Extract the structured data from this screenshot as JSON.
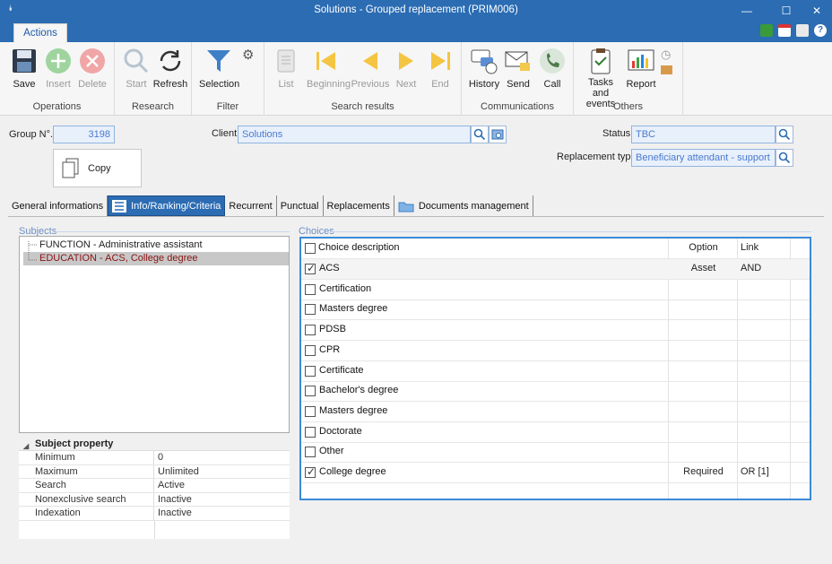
{
  "window": {
    "title": "Solutions - Grouped replacement (PRIM006)",
    "minimize": "—",
    "maximize": "☐",
    "close": "✕"
  },
  "ribbon_tab": "Actions",
  "ribbon": {
    "groups": [
      {
        "label": "Operations"
      },
      {
        "label": "Research"
      },
      {
        "label": "Filter"
      },
      {
        "label": "Search results"
      },
      {
        "label": "Communications"
      },
      {
        "label": "Others"
      }
    ],
    "buttons": {
      "save": "Save",
      "insert": "Insert",
      "delete": "Delete",
      "start": "Start",
      "refresh": "Refresh",
      "selection": "Selection",
      "list": "List",
      "beginning": "Beginning",
      "previous": "Previous",
      "next": "Next",
      "end": "End",
      "history": "History",
      "send": "Send",
      "call": "Call",
      "tasks_events": "Tasks and events",
      "report": "Report"
    }
  },
  "form": {
    "group_no_label": "Group N°.",
    "group_no_value": "3198",
    "client_label": "Client",
    "client_value": "Solutions",
    "status_label": "Status",
    "status_value": "TBC",
    "replacement_type_label": "Replacement type",
    "replacement_type_value": "Beneficiary attendant - support",
    "copy_button": "Copy"
  },
  "tabs": [
    {
      "label": "General informations"
    },
    {
      "label": "Info/Ranking/Criteria"
    },
    {
      "label": "Recurrent"
    },
    {
      "label": "Punctual"
    },
    {
      "label": "Replacements"
    },
    {
      "label": "Documents management"
    }
  ],
  "subjects": {
    "title": "Subjects",
    "items": [
      {
        "label": "FUNCTION - Administrative assistant"
      },
      {
        "label": "EDUCATION - ACS, College degree"
      }
    ]
  },
  "subject_property": {
    "title": "Subject property",
    "rows": [
      {
        "key": "Minimum",
        "value": "0"
      },
      {
        "key": "Maximum",
        "value": "Unlimited"
      },
      {
        "key": "Search",
        "value": "Active"
      },
      {
        "key": "Nonexclusive search",
        "value": "Inactive"
      },
      {
        "key": "Indexation",
        "value": "Inactive"
      }
    ]
  },
  "choices": {
    "title": "Choices",
    "header": {
      "description": "Choice description",
      "option": "Option",
      "link": "Link"
    },
    "rows": [
      {
        "label": "ACS",
        "checked": true,
        "option": "Asset",
        "link": "AND"
      },
      {
        "label": "Certification",
        "checked": false,
        "option": "",
        "link": ""
      },
      {
        "label": "Masters degree",
        "checked": false,
        "option": "",
        "link": ""
      },
      {
        "label": "PDSB",
        "checked": false,
        "option": "",
        "link": ""
      },
      {
        "label": "CPR",
        "checked": false,
        "option": "",
        "link": ""
      },
      {
        "label": "Certificate",
        "checked": false,
        "option": "",
        "link": ""
      },
      {
        "label": "Bachelor's degree",
        "checked": false,
        "option": "",
        "link": ""
      },
      {
        "label": "Masters degree",
        "checked": false,
        "option": "",
        "link": ""
      },
      {
        "label": "Doctorate",
        "checked": false,
        "option": "",
        "link": ""
      },
      {
        "label": "Other",
        "checked": false,
        "option": "",
        "link": ""
      },
      {
        "label": "College degree",
        "checked": true,
        "option": "Required",
        "link": "OR [1]"
      }
    ]
  }
}
